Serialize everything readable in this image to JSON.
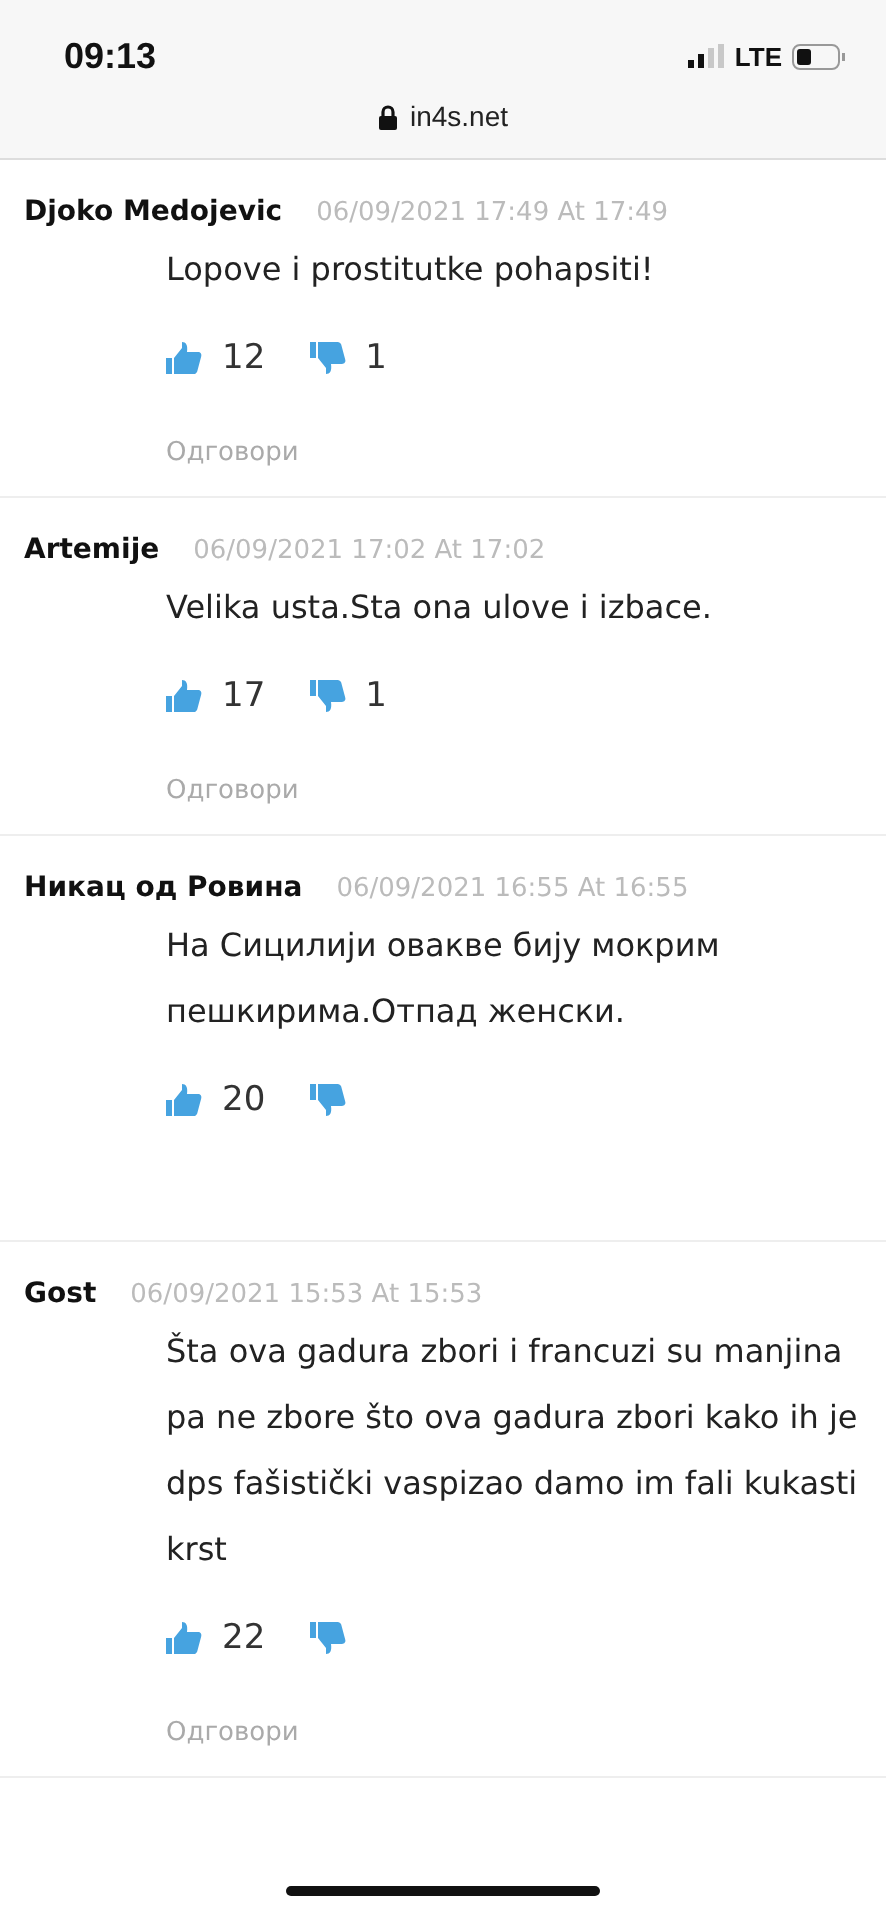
{
  "status_bar": {
    "time": "09:13",
    "network": "LTE"
  },
  "address_bar": {
    "url": "in4s.net"
  },
  "comments": [
    {
      "author": "Djoko Medojevic",
      "date": "06/09/2021 17:49 At 17:49",
      "text": "Lopove i prostitutke pohapsiti!",
      "likes": "12",
      "dislikes": "1",
      "reply": "Одговори"
    },
    {
      "author": "Artemije",
      "date": "06/09/2021 17:02 At 17:02",
      "text": "Velika usta.Sta ona ulove i izbace.",
      "likes": "17",
      "dislikes": "1",
      "reply": "Одговори"
    },
    {
      "author": "Никац од Ровина",
      "date": "06/09/2021 16:55 At 16:55",
      "text": "На Сицилији овакве бију мокрим пешкирима.Отпад женски.",
      "likes": "20"
    },
    {
      "author": "Gost",
      "date": "06/09/2021 15:53 At 15:53",
      "text": "Šta ova gadura zbori i francuzi su manjina pa ne zbore što ova gadura zbori kako ih je dps fašistički vaspizao damo im fali kukasti krst",
      "likes": "22",
      "reply": "Одговори"
    }
  ]
}
